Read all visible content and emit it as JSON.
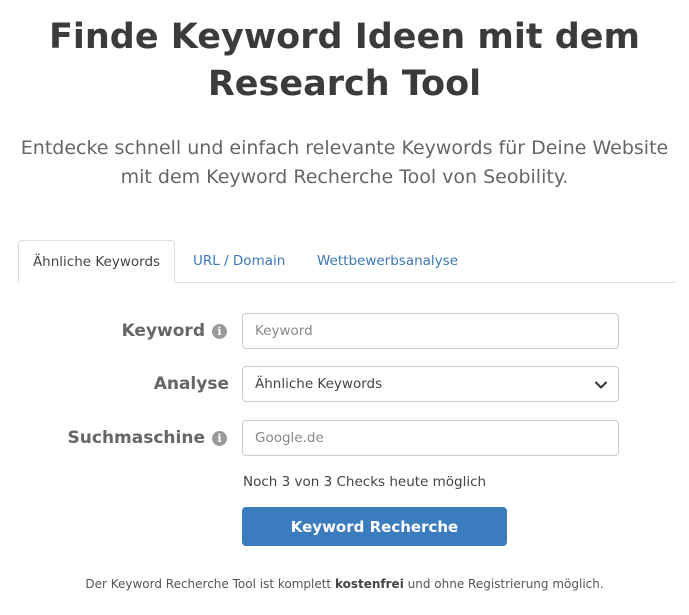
{
  "header": {
    "title_line1": "Finde Keyword Ideen mit dem",
    "title_line2": "Research Tool",
    "subtitle_line1": "Entdecke schnell und einfach relevante Keywords für Deine Website",
    "subtitle_line2": "mit dem Keyword Recherche Tool von Seobility."
  },
  "tabs": [
    {
      "label": "Ähnliche Keywords",
      "active": true
    },
    {
      "label": "URL / Domain",
      "active": false
    },
    {
      "label": "Wettbewerbsanalyse",
      "active": false
    }
  ],
  "form": {
    "keyword": {
      "label": "Keyword",
      "placeholder": "Keyword",
      "value": "",
      "icon": "info-icon"
    },
    "analysis": {
      "label": "Analyse",
      "selected": "Ähnliche Keywords",
      "icon": "chevron-down-icon"
    },
    "search_engine": {
      "label": "Suchmaschine",
      "placeholder": "Google.de",
      "value": "",
      "icon": "info-icon"
    },
    "checks_note": "Noch 3 von 3 Checks heute möglich",
    "submit_label": "Keyword Recherche"
  },
  "footer": {
    "text_before": "Der Keyword Recherche Tool ist komplett ",
    "text_bold": "kostenfrei",
    "text_after": " und ohne Registrierung möglich."
  },
  "colors": {
    "accent": "#3b7cbf",
    "link": "#3a78b8",
    "heading": "#3b3b3b"
  }
}
